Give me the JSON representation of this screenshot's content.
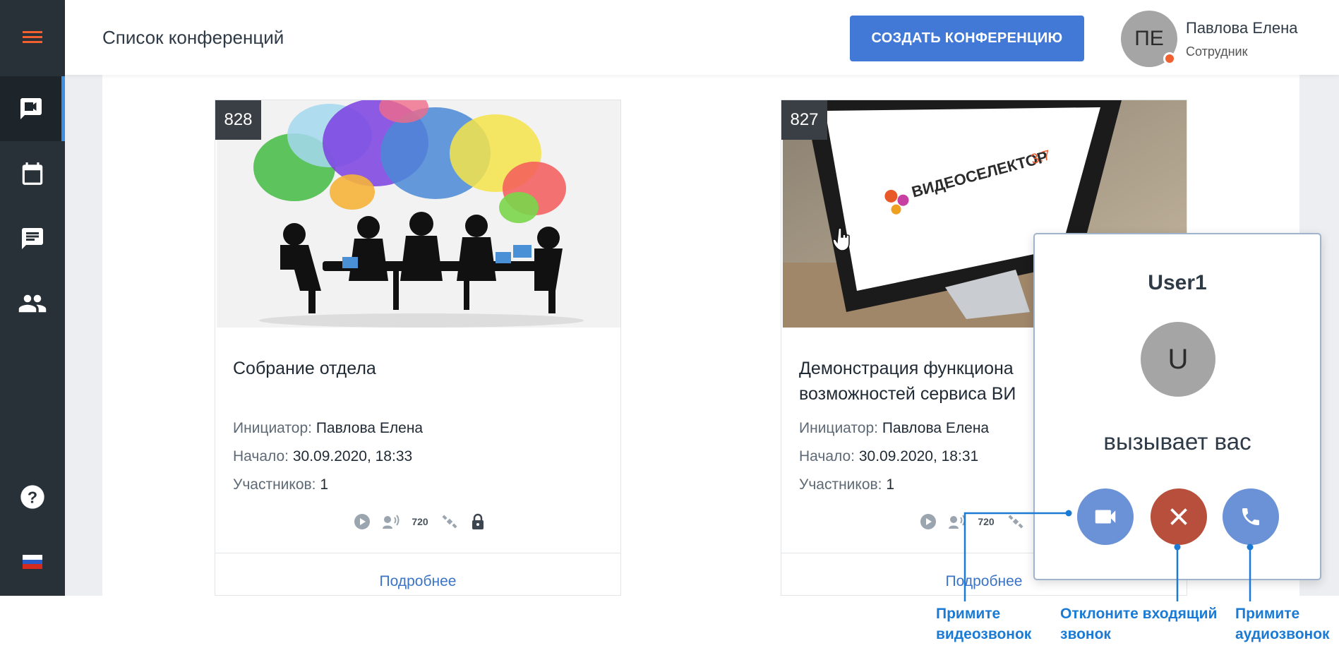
{
  "header": {
    "page_title": "Список конференций",
    "create_button": "СОЗДАТЬ КОНФЕРЕНЦИЮ",
    "user": {
      "initials": "ПЕ",
      "name": "Павлова Елена",
      "role": "Сотрудник"
    }
  },
  "sidebar": {
    "items": [
      {
        "icon": "menu-icon"
      },
      {
        "icon": "video-conference-icon",
        "active": true
      },
      {
        "icon": "calendar-icon"
      },
      {
        "icon": "chat-icon"
      },
      {
        "icon": "contacts-icon"
      },
      {
        "icon": "help-icon"
      },
      {
        "icon": "language-flag-icon"
      }
    ]
  },
  "cards": [
    {
      "id": "828",
      "title": "Собрание отдела",
      "initiator_label": "Инициатор:",
      "initiator": "Павлова Елена",
      "start_label": "Начало:",
      "start": "30.09.2020, 18:33",
      "participants_label": "Участников:",
      "participants": "1",
      "icons": [
        "play-icon",
        "voice-icon",
        "hd-720-icon",
        "satellite-icon",
        "lock-icon"
      ],
      "quality": "720",
      "more": "Подробнее"
    },
    {
      "id": "827",
      "title_line1": "Демонстрация функциона",
      "title_line2": "возможностей сервиса ВИ",
      "initiator_label": "Инициатор:",
      "initiator": "Павлова Елена",
      "start_label": "Начало:",
      "start": "30.09.2020, 18:31",
      "participants_label": "Участников:",
      "participants": "1",
      "icons": [
        "play-icon",
        "voice-icon",
        "hd-720-icon",
        "satellite-icon"
      ],
      "quality": "720",
      "more": "Подробнее",
      "image_text_brand": "ВИДЕОСЕЛЕКТОР",
      "image_text_version": "3.7"
    }
  ],
  "call": {
    "caller": "User1",
    "initial": "U",
    "text": "вызывает вас"
  },
  "callouts": {
    "video": {
      "line1": "Примите",
      "line2": "видеозвонок"
    },
    "decline": {
      "line1": "Отклоните входящий",
      "line2": "звонок"
    },
    "audio": {
      "line1": "Примите",
      "line2": "аудиозвонок"
    }
  },
  "colors": {
    "sidebar": "#283038",
    "accent_orange": "#f0612f",
    "primary_blue": "#4278d6",
    "call_blue": "#6b91d6",
    "decline_red": "#b84e3c",
    "callout_blue": "#1a7ad4"
  }
}
